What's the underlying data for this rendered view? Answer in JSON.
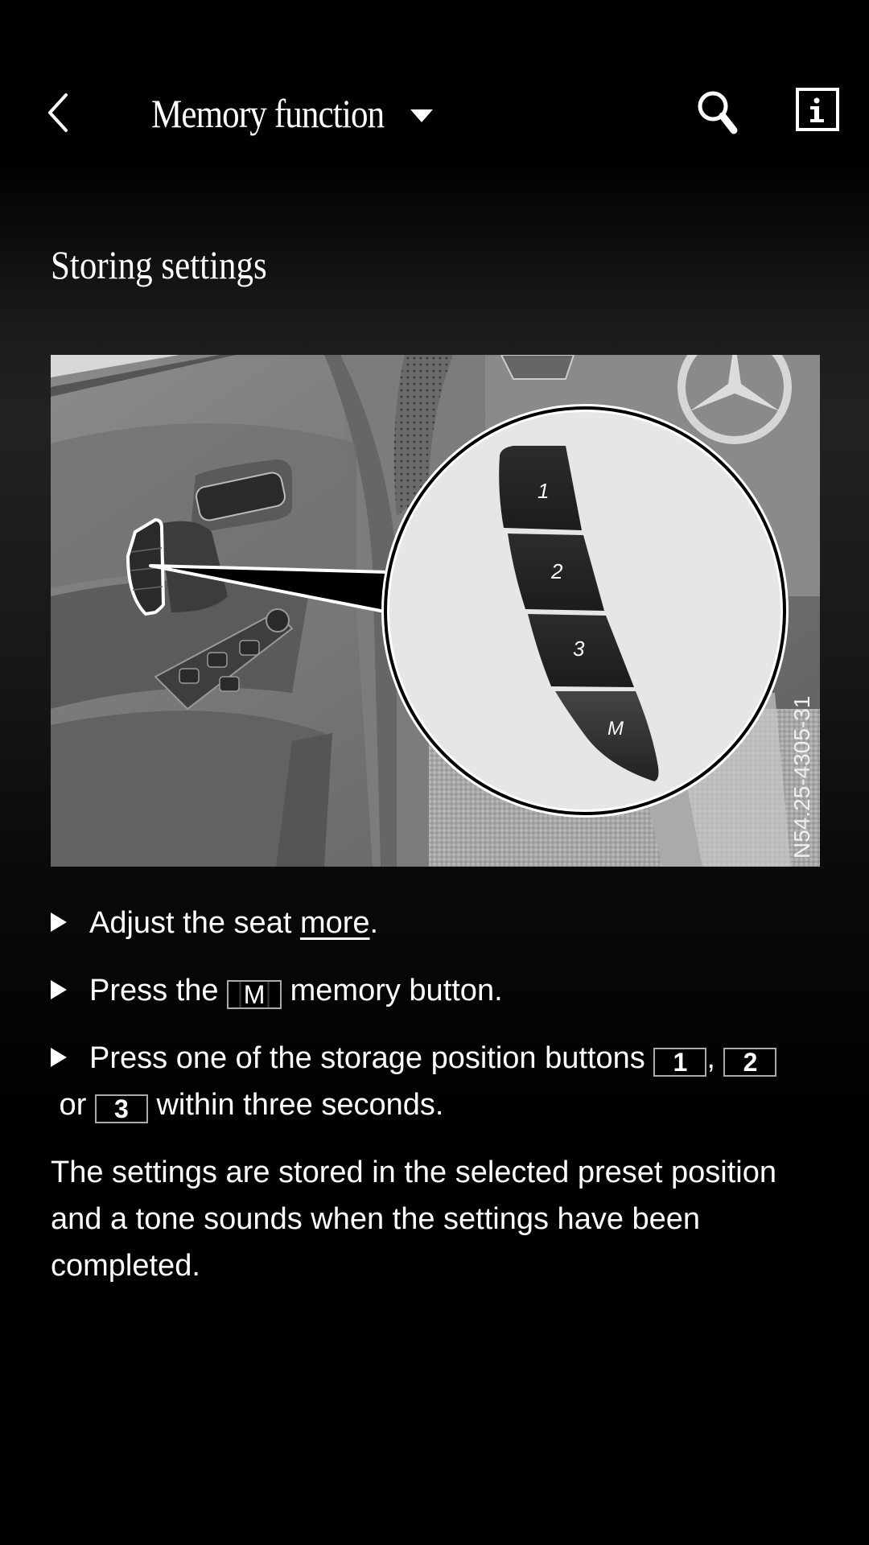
{
  "header": {
    "title": "Memory function",
    "back_icon": "chevron-left-icon",
    "dropdown_icon": "caret-down-icon",
    "search_icon": "search-icon",
    "info_icon": "info-icon"
  },
  "section": {
    "heading": "Storing settings"
  },
  "illustration": {
    "alt": "Door panel with seat memory buttons, magnified view of buttons 1, 2, 3 and M",
    "reference_code": "N54.25-4305-31",
    "magnified_buttons": [
      "1",
      "2",
      "3",
      "M"
    ]
  },
  "steps": [
    {
      "prefix": "Adjust the seat ",
      "link": "more",
      "suffix": "."
    },
    {
      "prefix": "Press the ",
      "key": "M",
      "suffix": " memory button."
    },
    {
      "prefix": "Press one of the storage position buttons ",
      "key1": "1",
      "sep1": ", ",
      "key2": "2",
      "sep2": " or ",
      "key3": "3",
      "suffix": " within three seconds."
    }
  ],
  "result": "The settings are stored in the selected preset position and a tone sounds when the settings have been completed.",
  "colors": {
    "background": "#000000",
    "text": "#ffffff",
    "keycap_border": "#aaaaaa"
  }
}
